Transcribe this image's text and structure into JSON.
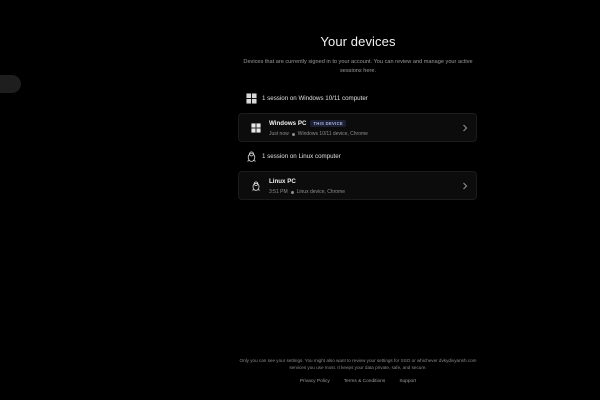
{
  "header": {
    "title": "Your devices",
    "subtitle": "Devices that are currently signed in to your account. You can review and manage your active sessions here."
  },
  "groups": [
    {
      "heading": "1 session on Windows 10/11 computer",
      "icon": "windows-icon",
      "device": {
        "name": "Windows PC",
        "badge": "THIS DEVICE",
        "time": "Just now",
        "details": "Windows 10/11 device, Chrome"
      }
    },
    {
      "heading": "1 session on Linux computer",
      "icon": "linux-icon",
      "device": {
        "name": "Linux PC",
        "time": "3:51 PM",
        "details": "Linux device, Chrome"
      }
    }
  ],
  "footer": {
    "text": "Only you can see your settings. You might also want to review your settings for SSO or whichever dvkydivyansh.com services you use most. It keeps your data private, safe, and secure.",
    "links": [
      "Privacy Policy",
      "Terms & Conditions",
      "Support"
    ]
  },
  "colors": {
    "background": "#000000",
    "card": "#0c0c0c",
    "badge_bg": "#1b1f33",
    "badge_text": "#aeb8e0"
  }
}
